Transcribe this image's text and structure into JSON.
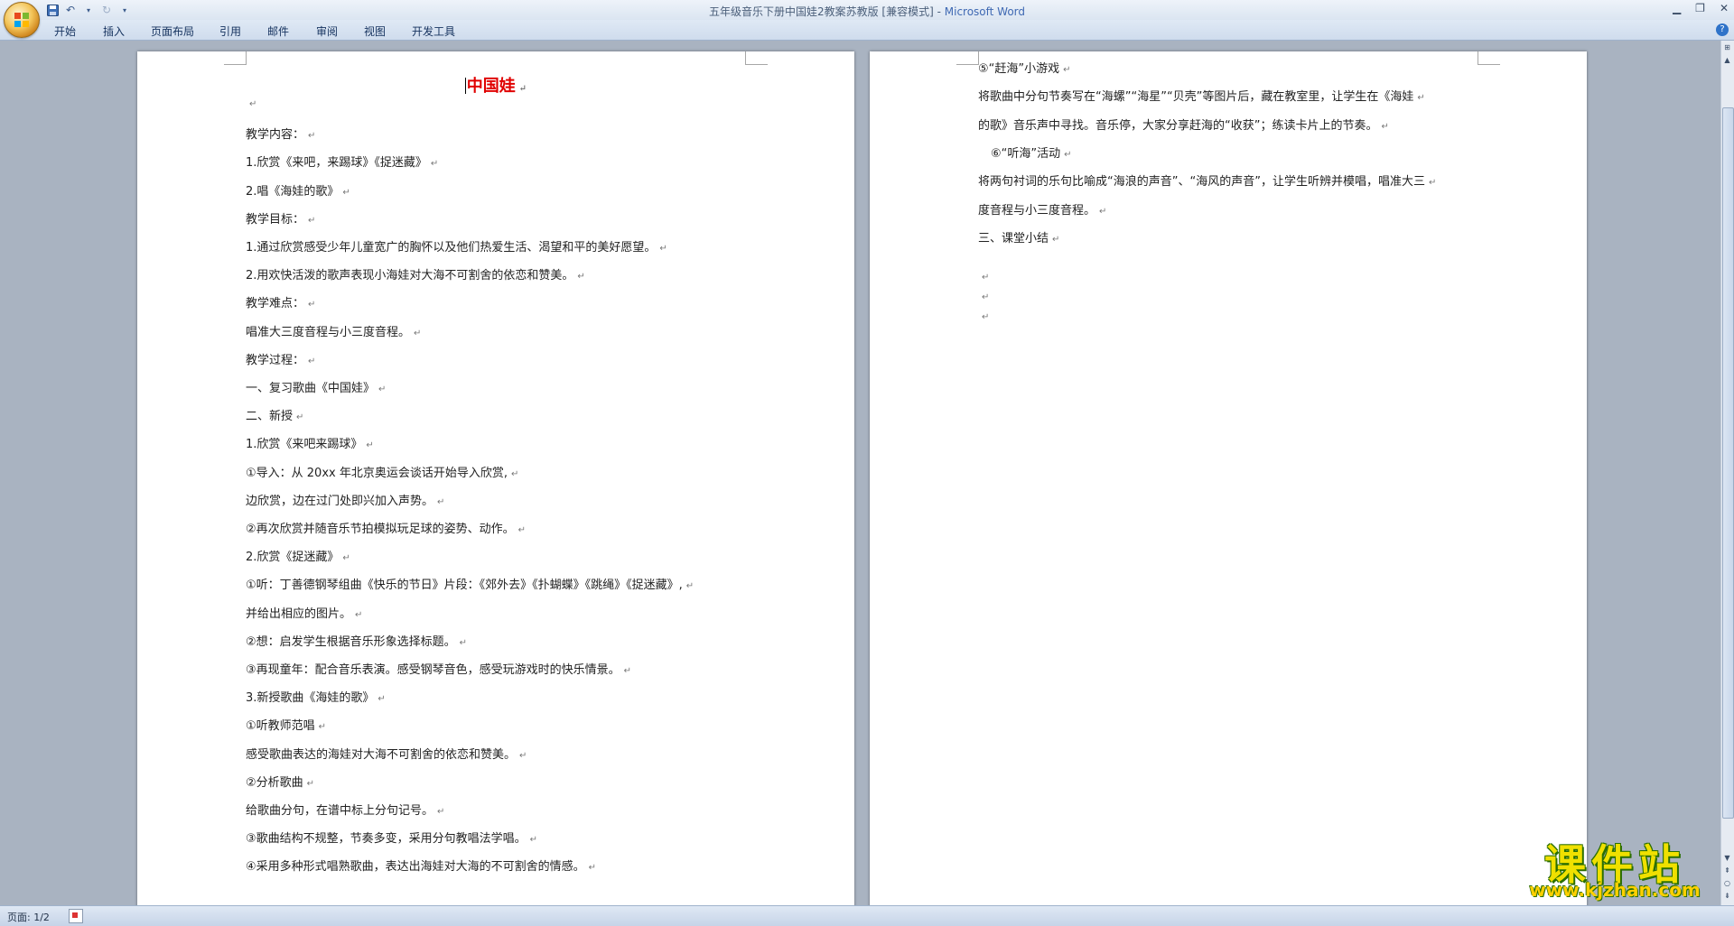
{
  "window": {
    "title_doc": "五年级音乐下册中国娃2教案苏教版 [兼容模式]",
    "title_sep": " - ",
    "title_app": "Microsoft Word"
  },
  "ribbon": {
    "tabs": [
      "开始",
      "插入",
      "页面布局",
      "引用",
      "邮件",
      "审阅",
      "视图",
      "开发工具"
    ]
  },
  "page1": {
    "title": "中国娃",
    "lines": [
      "",
      "教学内容：",
      "1.欣赏《来吧，来踢球》《捉迷藏》",
      "2.唱《海娃的歌》",
      "教学目标：",
      "1.通过欣赏感受少年儿童宽广的胸怀以及他们热爱生活、渴望和平的美好愿望。",
      "2.用欢快活泼的歌声表现小海娃对大海不可割舍的依恋和赞美。",
      "教学难点：",
      "唱准大三度音程与小三度音程。",
      "教学过程：",
      "一、复习歌曲《中国娃》",
      "二、新授",
      "1.欣赏《来吧来踢球》",
      "①导入：从 20xx 年北京奥运会谈话开始导入欣赏,",
      "边欣赏，边在过门处即兴加入声势。",
      "②再次欣赏并随音乐节拍模拟玩足球的姿势、动作。",
      "2.欣赏《捉迷藏》",
      "①听：丁善德钢琴组曲《快乐的节日》片段：《郊外去》《扑蝴蝶》《跳绳》《捉迷藏》,",
      "并给出相应的图片。",
      "②想：启发学生根据音乐形象选择标题。",
      "③再现童年：配合音乐表演。感受钢琴音色，感受玩游戏时的快乐情景。",
      "3.新授歌曲《海娃的歌》",
      "①听教师范唱",
      "感受歌曲表达的海娃对大海不可割舍的依恋和赞美。",
      "②分析歌曲",
      "给歌曲分句，在谱中标上分句记号。",
      "③歌曲结构不规整，节奏多变，采用分句教唱法学唱。",
      "④采用多种形式唱熟歌曲，表达出海娃对大海的不可割舍的情感。"
    ]
  },
  "page2": {
    "lines": [
      "⑤“赶海”小游戏",
      "将歌曲中分句节奏写在“海螺”“海星”“贝壳”等图片后，藏在教室里，让学生在《海娃",
      "的歌》音乐声中寻找。音乐停，大家分享赶海的“收获”；练读卡片上的节奏。",
      "⑥“听海”活动",
      "将两句衬词的乐句比喻成“海浪的声音”、“海风的声音”，让学生听辨并模唱，唱准大三",
      "度音程与小三度音程。",
      "三、课堂小结",
      "",
      "",
      ""
    ]
  },
  "status": {
    "page": "页面: 1/2"
  },
  "watermark": {
    "cn": "课件站",
    "url": "www.kjzhan.com"
  }
}
